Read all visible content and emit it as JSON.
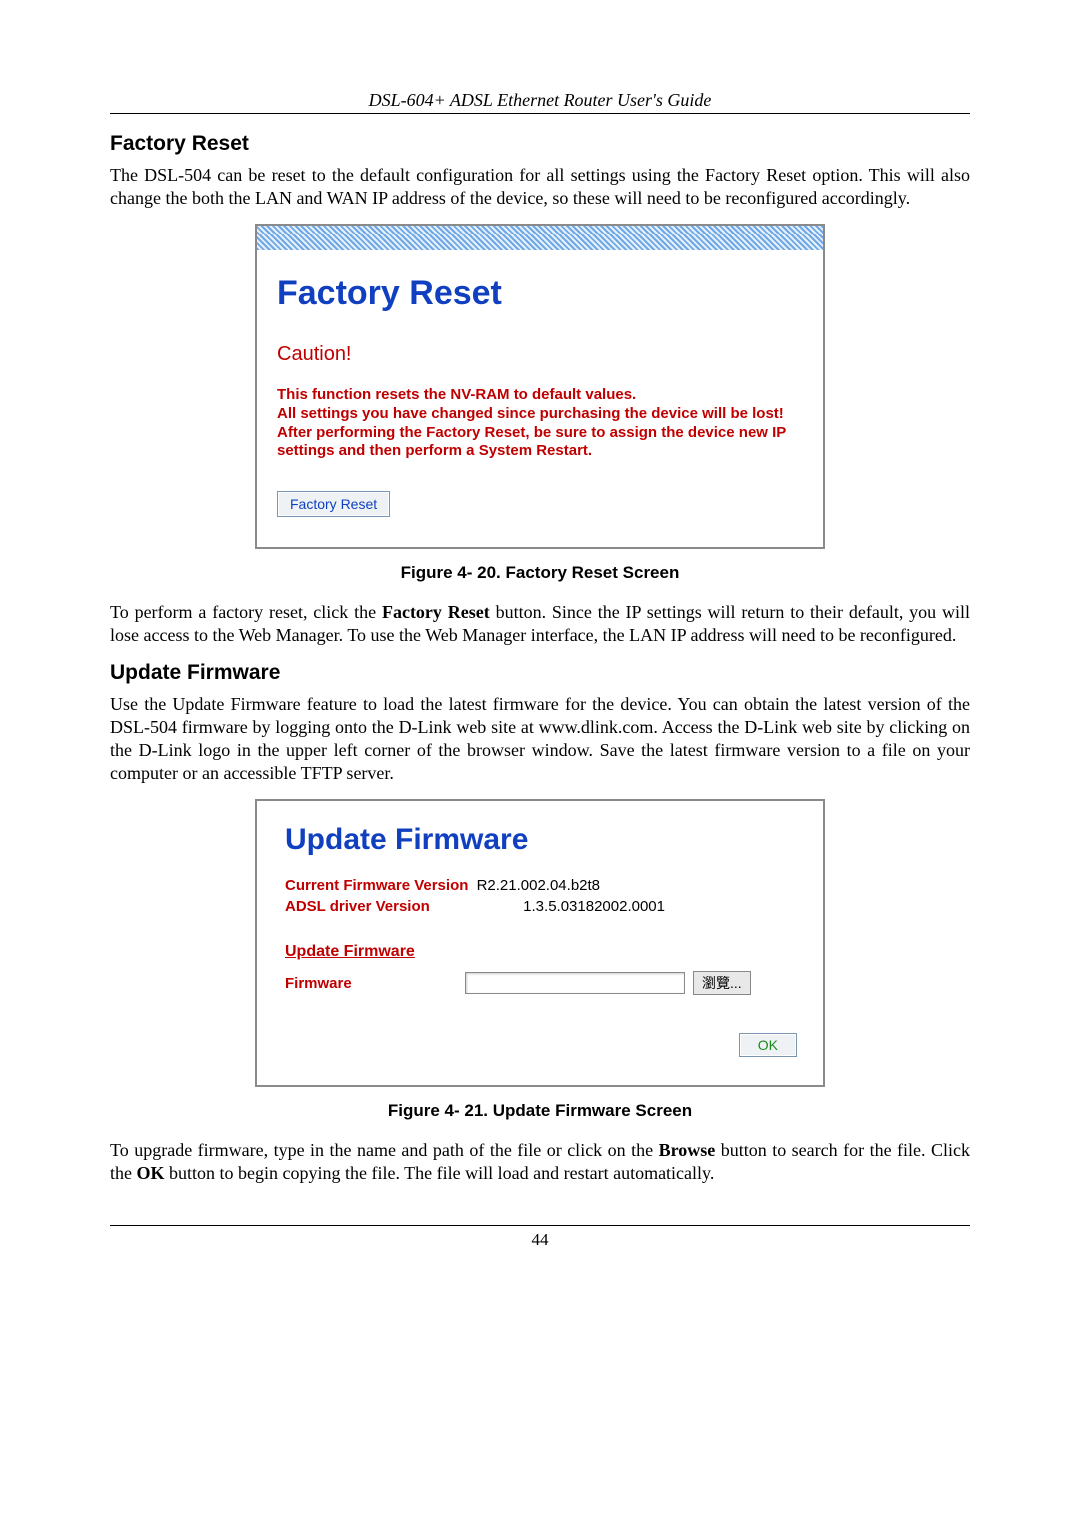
{
  "header": {
    "running_head": "DSL-604+ ADSL Ethernet Router User's Guide"
  },
  "sec1": {
    "heading": "Factory Reset",
    "para1": "The DSL-504 can be reset to the default configuration for all settings using the Factory Reset option. This will also change the both the LAN and WAN IP address of the device, so these will need to be reconfigured accordingly."
  },
  "fig1": {
    "title": "Factory Reset",
    "caution": "Caution!",
    "warn": "This function resets the NV-RAM to default values.\nAll settings you have changed since purchasing the device will be lost!\nAfter performing the Factory Reset, be sure to assign the device new IP settings and then perform a System Restart.",
    "button": "Factory Reset",
    "caption": "Figure 4- 20. Factory Reset Screen"
  },
  "sec1b": {
    "para1_pre": "To perform a factory reset, click the ",
    "para1_bold": "Factory Reset",
    "para1_post": " button. Since the IP settings will return to their default, you will lose access to the Web Manager. To use the Web Manager interface, the LAN IP address will need to be reconfigured."
  },
  "sec2": {
    "heading": "Update Firmware",
    "para1": "Use the Update Firmware feature to load the latest firmware for the device. You can obtain the latest version of the DSL-504 firmware by logging onto the D-Link web site at www.dlink.com. Access the D-Link web site by clicking on the D-Link logo in the upper left corner of the browser window. Save the latest firmware version to a file on your computer or an accessible TFTP server."
  },
  "fig2": {
    "title": "Update Firmware",
    "row1_label": "Current Firmware Version",
    "row1_value": "R2.21.002.04.b2t8",
    "row2_label": "ADSL driver Version",
    "row2_value": "1.3.5.03182002.0001",
    "section_label": "Update Firmware",
    "firmware_label": "Firmware",
    "browse_label": "瀏覽...",
    "ok_label": "OK",
    "caption": "Figure 4- 21. Update Firmware Screen"
  },
  "sec2b": {
    "para1_pre": "To upgrade firmware, type in the name and path of the file or click on the ",
    "para1_bold1": "Browse",
    "para1_mid": " button to search for the file. Click the ",
    "para1_bold2": "OK",
    "para1_post": " button to begin copying the file. The file will load and restart automatically."
  },
  "footer": {
    "page_no": "44"
  }
}
